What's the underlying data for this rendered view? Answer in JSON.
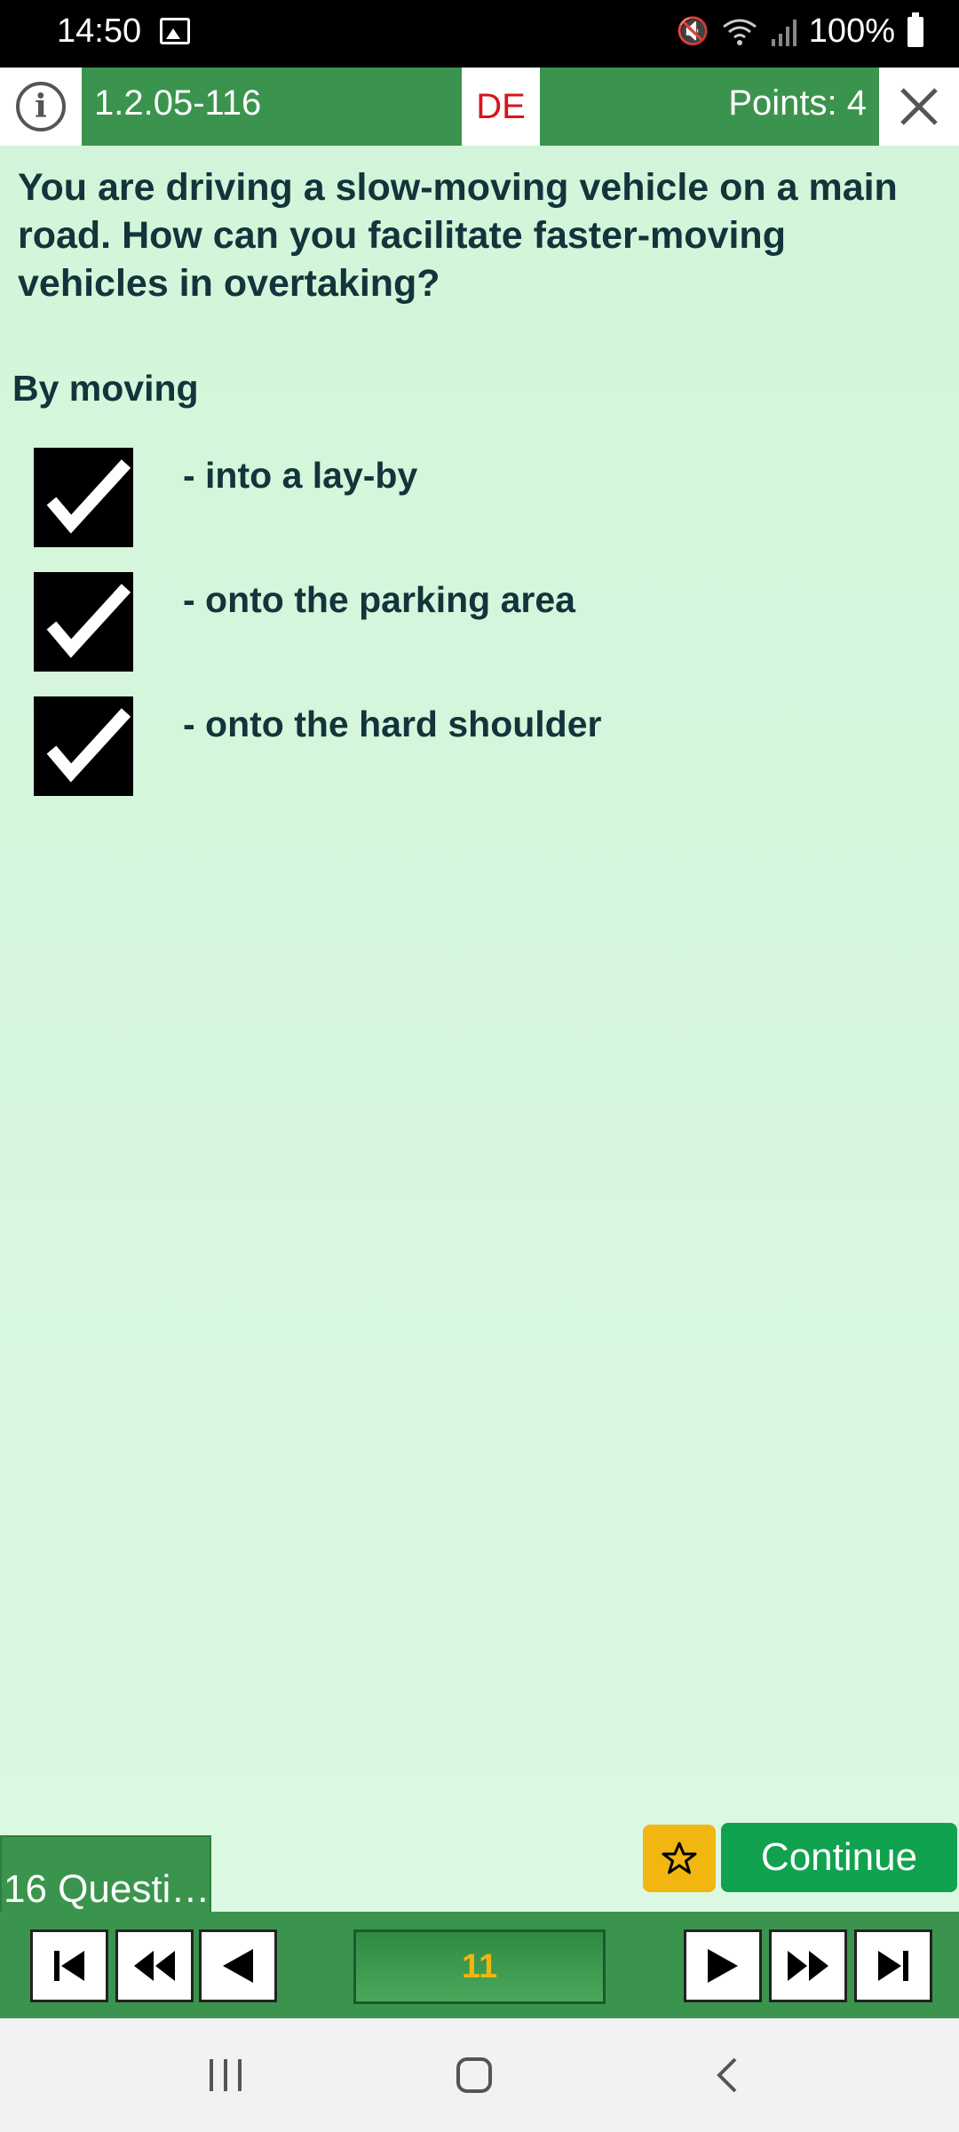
{
  "status_bar": {
    "time": "14:50",
    "battery": "100%"
  },
  "header": {
    "question_id": "1.2.05-116",
    "language": "DE",
    "points": "Points: 4"
  },
  "question": {
    "text": "You are driving a slow-moving vehicle on a main road. How can you facilitate faster-moving vehicles in overtaking?",
    "stem": "By moving",
    "answers": [
      {
        "label": "- into a lay-by",
        "checked": true
      },
      {
        "label": "- onto the parking area",
        "checked": true
      },
      {
        "label": "- onto the hard shoulder",
        "checked": true
      }
    ]
  },
  "footer": {
    "questions_tab": "16 Questi…",
    "continue_label": "Continue",
    "current_page": "11"
  },
  "icons": {
    "info": "info-icon",
    "close": "close-icon",
    "star": "star-icon",
    "first": "skip-first-icon",
    "rewind": "rewind-icon",
    "prev": "previous-icon",
    "next": "next-icon",
    "fast_forward": "fast-forward-icon",
    "last": "skip-last-icon",
    "recent_apps": "recent-apps-icon",
    "home": "home-icon",
    "back": "back-icon"
  },
  "colors": {
    "header_green": "#3b944d",
    "content_bg": "#d2f5d9",
    "continue_green": "#10a24e",
    "star_yellow": "#f1b60f",
    "lang_red": "#d8141c"
  }
}
